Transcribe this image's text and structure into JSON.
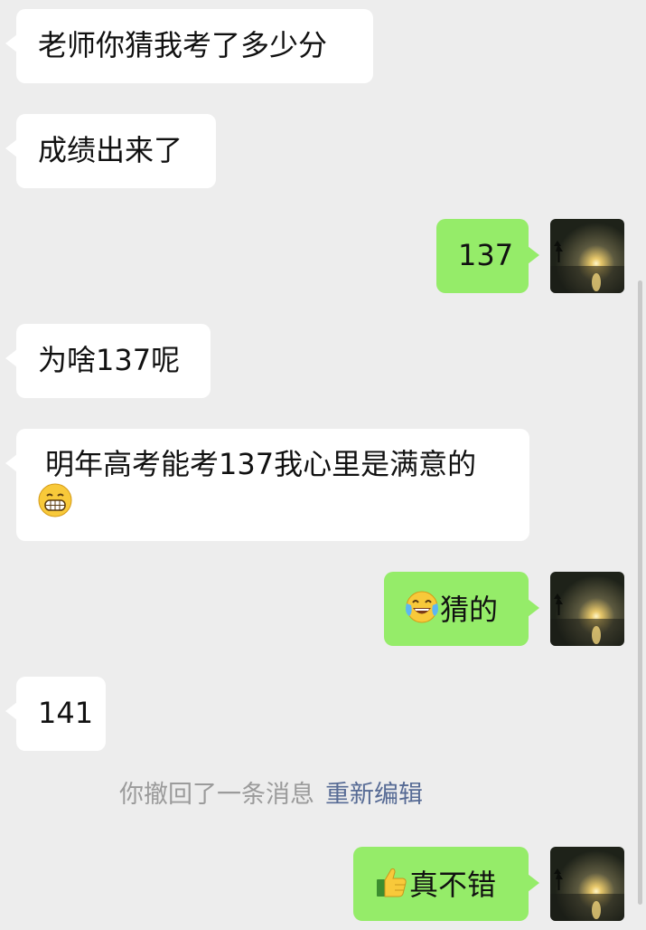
{
  "colors": {
    "background": "#ededed",
    "incoming_bubble": "#ffffff",
    "outgoing_bubble": "#95ec69",
    "system_text": "#9b9b9b",
    "link": "#576b95"
  },
  "messages": [
    {
      "side": "incoming",
      "text": "老师你猜我考了多少分"
    },
    {
      "side": "incoming",
      "text": "成绩出来了"
    },
    {
      "side": "outgoing",
      "text": "137"
    },
    {
      "side": "incoming",
      "text": "为啥137呢"
    },
    {
      "side": "incoming",
      "text": "明年高考能考137我心里是满意的",
      "emoji": "grinning-face-icon"
    },
    {
      "side": "outgoing",
      "text": "猜的",
      "emoji": "tears-of-joy-icon"
    },
    {
      "side": "incoming",
      "text": "141"
    },
    {
      "side": "outgoing",
      "text": "真不错",
      "emoji": "thumbs-up-icon"
    }
  ],
  "system": {
    "recall_text": "你撤回了一条消息",
    "reedit_link": "重新编辑"
  },
  "avatar": {
    "icon": "sunset-lake-avatar"
  }
}
